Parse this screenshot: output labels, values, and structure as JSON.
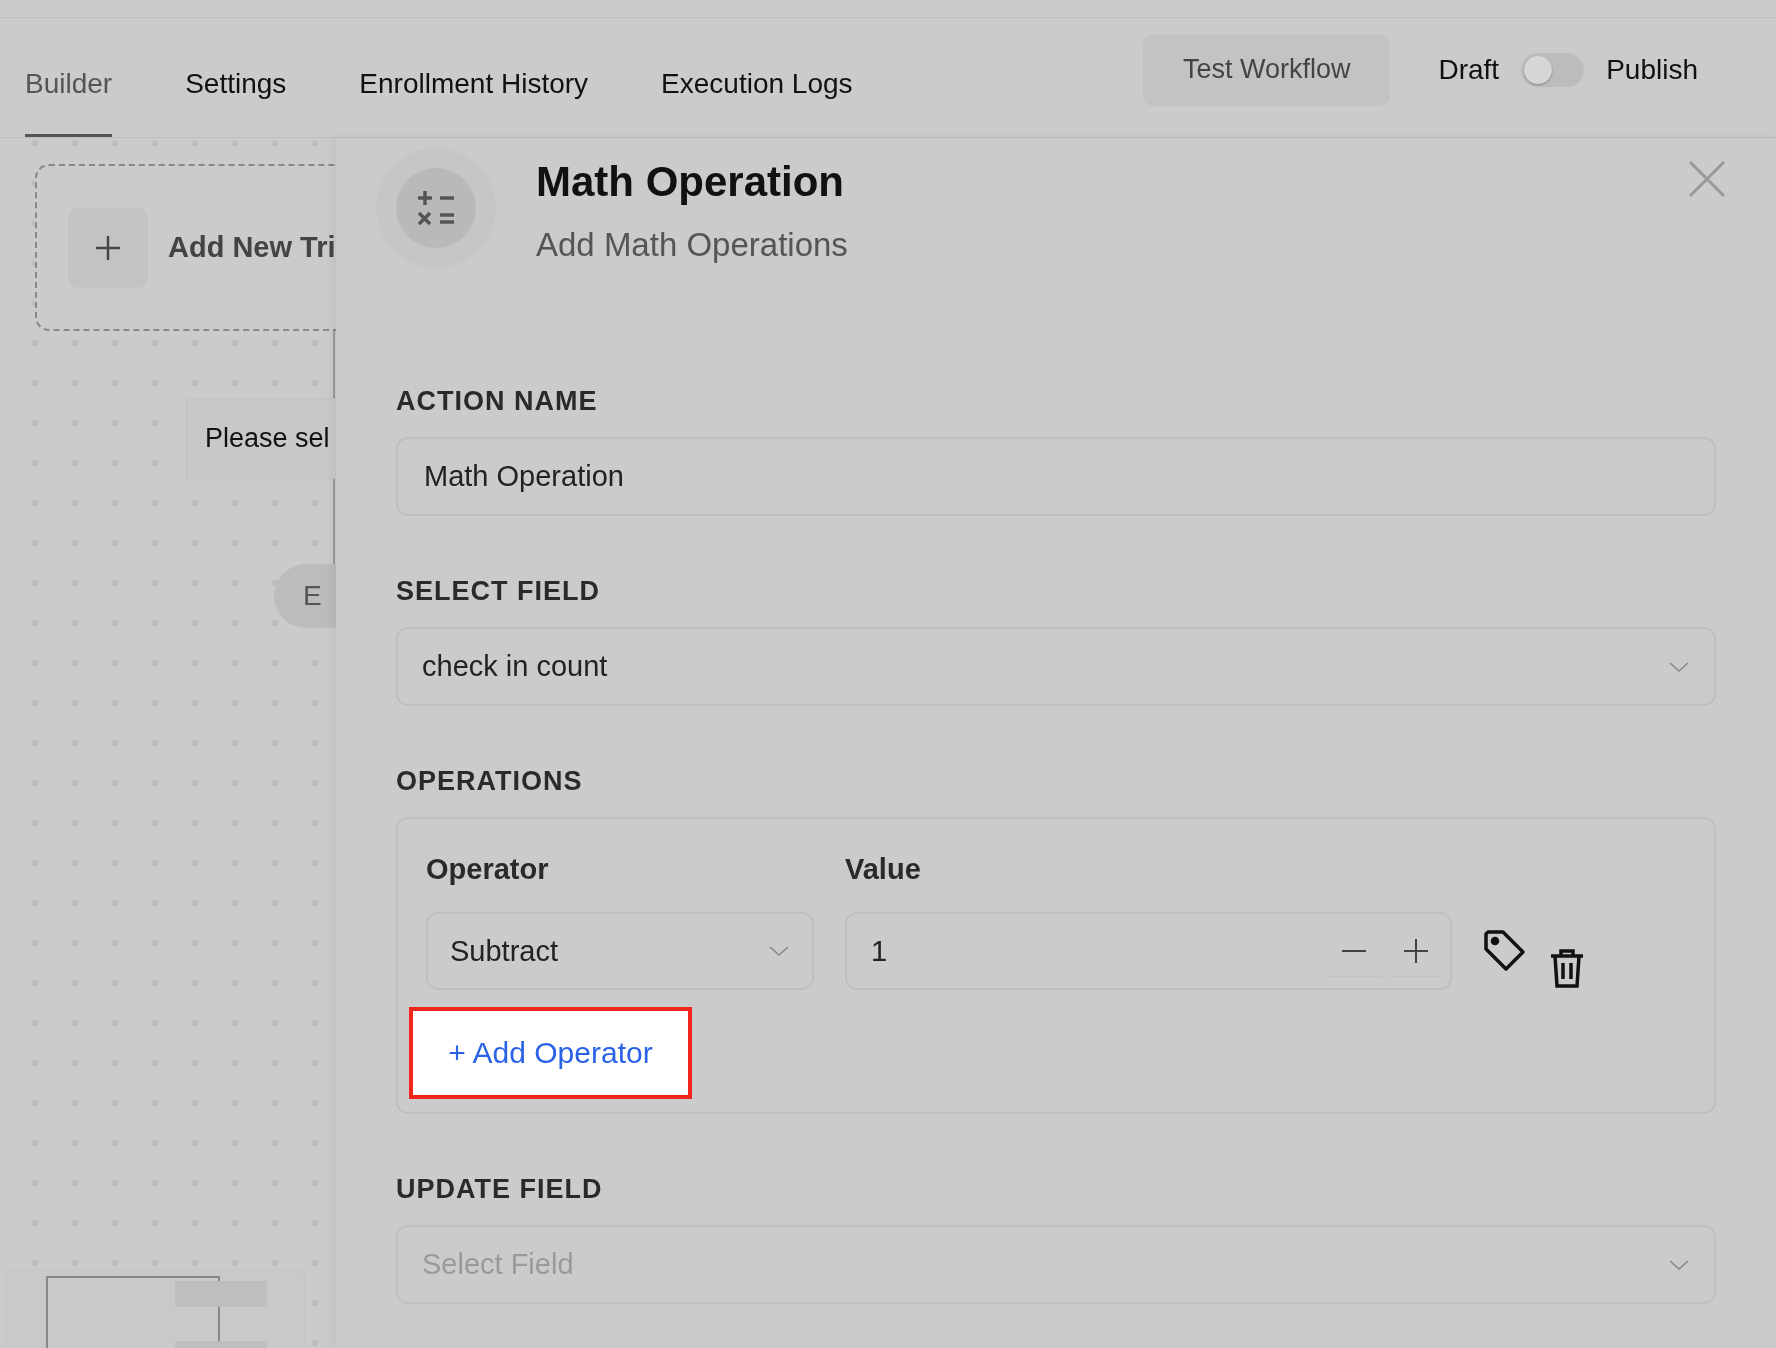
{
  "tabs": [
    {
      "label": "Builder",
      "selected": true
    },
    {
      "label": "Settings",
      "selected": false
    },
    {
      "label": "Enrollment History",
      "selected": false
    },
    {
      "label": "Execution Logs",
      "selected": false
    }
  ],
  "test_button": "Test Workflow",
  "publish_toggle": {
    "off_label": "Draft",
    "on_label": "Publish",
    "on": false
  },
  "canvas": {
    "trigger_card": "Add New Tri",
    "placeholder_node": "Please sel",
    "end_node": "E"
  },
  "panel": {
    "title": "Math Operation",
    "subtitle": "Add Math Operations",
    "action_name": {
      "label": "ACTION NAME",
      "value": "Math Operation"
    },
    "select_field": {
      "label": "SELECT FIELD",
      "value": "check in count"
    },
    "operations": {
      "label": "OPERATIONS",
      "columns": [
        "Operator",
        "Value"
      ],
      "rows": [
        {
          "operator": "Subtract",
          "value": "1"
        }
      ],
      "add_button": "+ Add Operator"
    },
    "update_field": {
      "label": "UPDATE FIELD",
      "placeholder": "Select Field"
    }
  }
}
